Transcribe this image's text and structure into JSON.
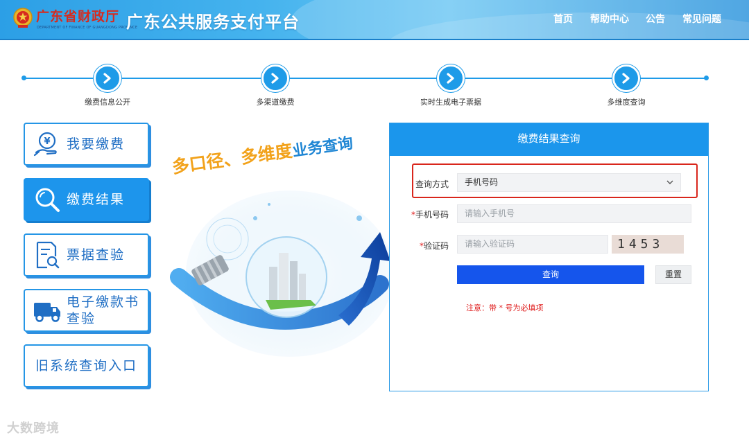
{
  "header": {
    "dept_name": "广东省财政厅",
    "dept_subtitle": "DEPARTMENT OF FINANCE OF GUANGDONG PROVINCE",
    "platform_title": "广东公共服务支付平台",
    "nav": [
      {
        "label": "首页"
      },
      {
        "label": "帮助中心"
      },
      {
        "label": "公告"
      },
      {
        "label": "常见问题"
      }
    ]
  },
  "steps": [
    {
      "label": "缴费信息公开",
      "icon": "chevron-right-icon"
    },
    {
      "label": "多渠道缴费",
      "icon": "chevron-right-icon"
    },
    {
      "label": "实时生成电子票据",
      "icon": "chevron-right-icon"
    },
    {
      "label": "多维度查询",
      "icon": "chevron-right-icon"
    }
  ],
  "menu": [
    {
      "label": "我要缴费",
      "icon": "payment-hand-icon",
      "active": false
    },
    {
      "label": "缴费结果",
      "icon": "search-icon",
      "active": true
    },
    {
      "label": "票据查验",
      "icon": "document-search-icon",
      "active": false
    },
    {
      "label_line1": "电子缴款书",
      "label_line2": "查验",
      "icon": "truck-icon",
      "active": false
    },
    {
      "label": "旧系统查询入口",
      "active": false
    }
  ],
  "slogan": {
    "part1": "多口径、多维度",
    "part2": "业务查询"
  },
  "panel": {
    "title": "缴费结果查询",
    "query_method_label": "查询方式",
    "query_method_value": "手机号码",
    "phone_label": "手机号码",
    "phone_placeholder": "请输入手机号",
    "captcha_label": "验证码",
    "captcha_placeholder": "请输入验证码",
    "captcha_text": "1453",
    "query_button": "查询",
    "reset_button": "重置",
    "required_marker": "*",
    "note": "注意：带 * 号为必填项"
  },
  "colors": {
    "primary": "#1b96ec",
    "query_button": "#1555ec",
    "highlight_box": "#d9261c",
    "required": "#e02020"
  },
  "watermark": "大数跨境"
}
